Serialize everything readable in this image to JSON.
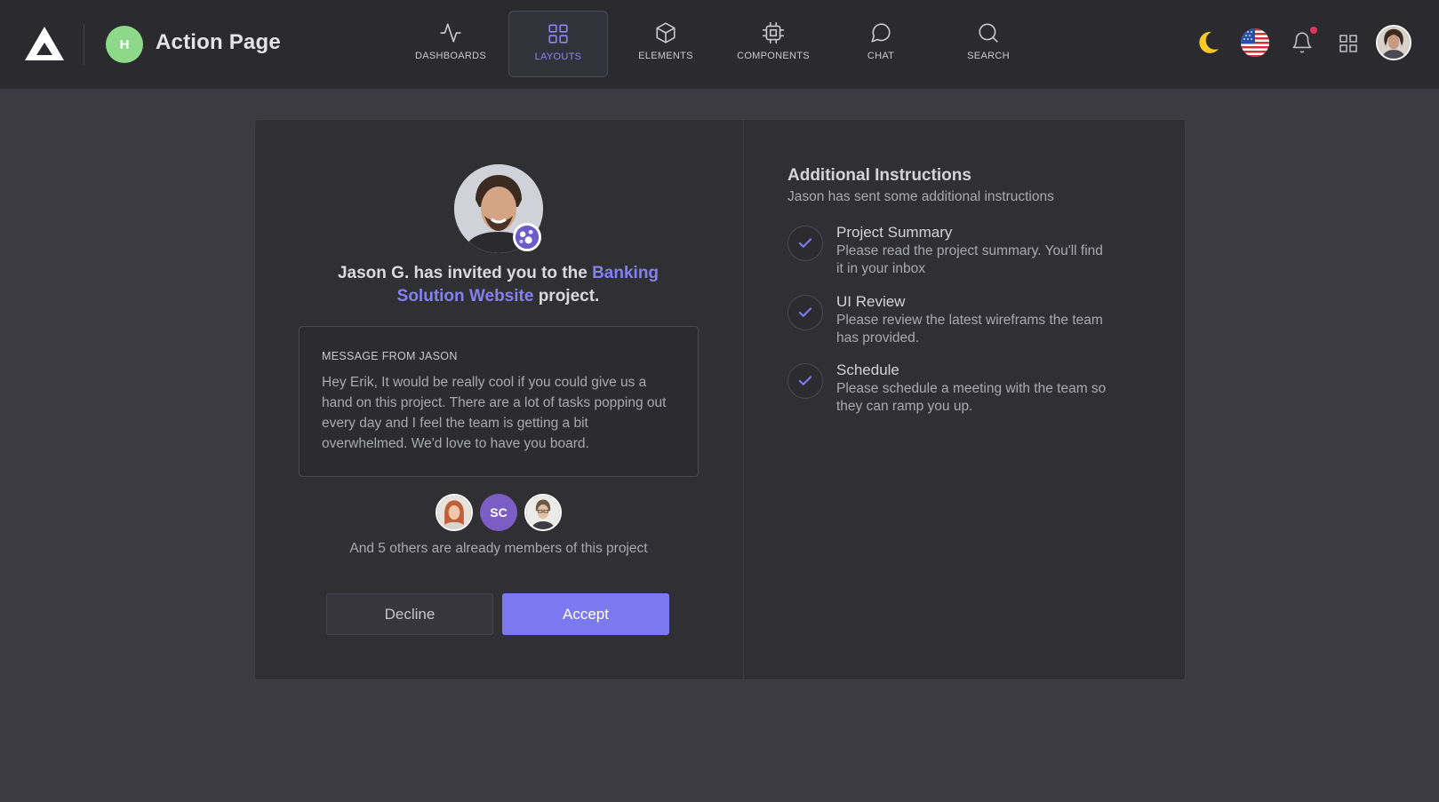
{
  "header": {
    "page_badge": "H",
    "page_title": "Action Page",
    "nav": [
      {
        "label": "DASHBOARDS",
        "icon": "activity-icon",
        "active": false
      },
      {
        "label": "LAYOUTS",
        "icon": "grid-icon",
        "active": true
      },
      {
        "label": "ELEMENTS",
        "icon": "cube-icon",
        "active": false
      },
      {
        "label": "COMPONENTS",
        "icon": "cpu-icon",
        "active": false
      },
      {
        "label": "CHAT",
        "icon": "chat-icon",
        "active": false
      },
      {
        "label": "SEARCH",
        "icon": "search-icon",
        "active": false
      }
    ]
  },
  "invite": {
    "prefix": "Jason G. has invited you to the ",
    "project": "Banking Solution Website",
    "suffix": " project.",
    "message_title": "MESSAGE FROM JASON",
    "message_body": "Hey Erik, It would be really cool if you could give us a hand on this project. There are a lot of tasks popping out every day and I feel the team is getting a bit overwhelmed. We'd love to have you board.",
    "member_initials": "SC",
    "members_text": "And 5 others are already members of this project",
    "decline_label": "Decline",
    "accept_label": "Accept"
  },
  "instructions": {
    "title": "Additional Instructions",
    "subtitle": "Jason has sent some additional instructions",
    "steps": [
      {
        "title": "Project Summary",
        "desc": "Please read the project summary. You'll find it in your inbox"
      },
      {
        "title": "UI Review",
        "desc": "Please review the latest wireframs the team has provided."
      },
      {
        "title": "Schedule",
        "desc": "Please schedule a meeting with the team so they can ramp you up."
      }
    ]
  },
  "colors": {
    "accent": "#7b78f0",
    "background": "#3b3b41",
    "topbar": "#2a2a2f",
    "card": "#2f2f34",
    "badge_green": "#8ed88a"
  }
}
